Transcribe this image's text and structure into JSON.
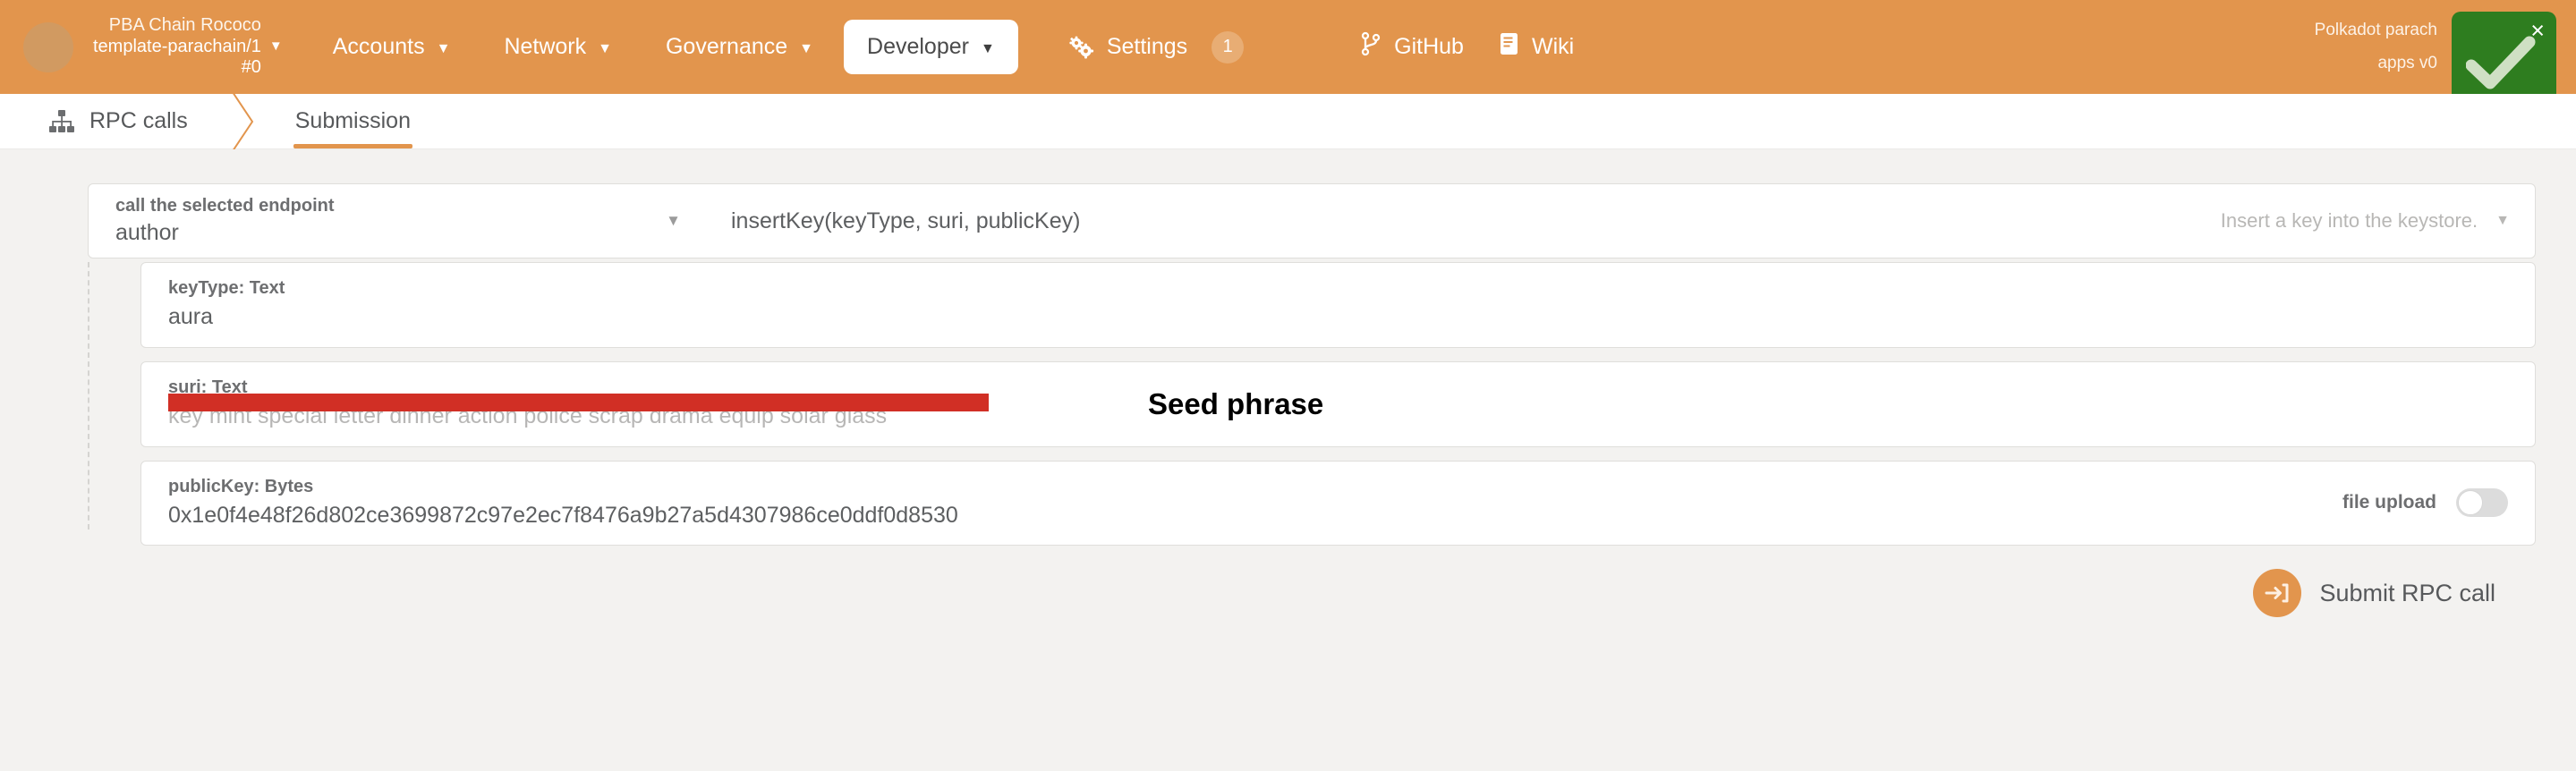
{
  "topbar": {
    "chain": {
      "name": "PBA Chain Rococo",
      "spec": "template-parachain/1",
      "block": "#0",
      "caret": "▼"
    },
    "nav": [
      {
        "label": "Accounts",
        "caret": "▼",
        "active": false
      },
      {
        "label": "Network",
        "caret": "▼",
        "active": false
      },
      {
        "label": "Governance",
        "caret": "▼",
        "active": false
      },
      {
        "label": "Developer",
        "caret": "▼",
        "active": true
      }
    ],
    "settings": {
      "label": "Settings",
      "icon": "gear-icon",
      "badge": "1"
    },
    "external": [
      {
        "label": "GitHub",
        "icon": "git-branch-icon"
      },
      {
        "label": "Wiki",
        "icon": "book-icon"
      }
    ],
    "version": {
      "line1": "Polkadot parach",
      "line2": "apps v0"
    },
    "toast": {
      "icon": "check-icon",
      "close": "×"
    }
  },
  "tabs": [
    {
      "label": "RPC calls",
      "icon": "sitemap-icon",
      "active": false
    },
    {
      "label": "Submission",
      "icon": "",
      "active": true
    }
  ],
  "form": {
    "endpoint": {
      "label": "call the selected endpoint",
      "value": "author",
      "caret": "▼",
      "method": "insertKey(keyType, suri, publicKey)",
      "hint": "Insert a key into the keystore.",
      "hint_caret": "▼"
    },
    "fields": [
      {
        "label": "keyType: Text",
        "value": "aura",
        "redacted": false,
        "annotation": "",
        "toggle": null
      },
      {
        "label": "suri: Text",
        "value": "key mint special letter dinner action police scrap drama equip solar glass",
        "redacted": true,
        "annotation": "Seed phrase",
        "toggle": null
      },
      {
        "label": "publicKey: Bytes",
        "value": "0x1e0f4e48f26d802ce3699872c97e2ec7f8476a9b27a5d4307986ce0ddf0d8530",
        "redacted": false,
        "annotation": "",
        "toggle": {
          "label": "file upload",
          "on": false
        }
      }
    ],
    "submit": {
      "label": "Submit RPC call",
      "icon": "sign-in-icon"
    }
  },
  "colors": {
    "brand_orange": "#e2954d",
    "toast_green": "#2e7d1f",
    "redaction_red": "#d12f25"
  }
}
